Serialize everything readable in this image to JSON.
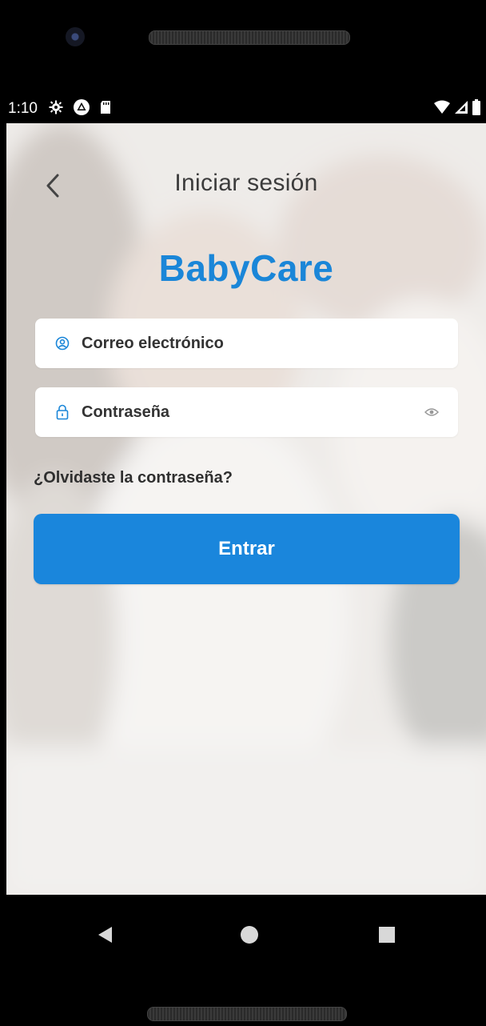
{
  "status_bar": {
    "time": "1:10",
    "icons": [
      "gear-icon",
      "alert-icon",
      "sd-card-icon",
      "wifi-icon",
      "signal-icon",
      "battery-icon"
    ]
  },
  "header": {
    "back_icon": "chevron-left-icon",
    "title": "Iniciar sesión"
  },
  "brand": {
    "name": "BabyCare",
    "color": "#1a86d8"
  },
  "form": {
    "email": {
      "placeholder": "Correo electrónico",
      "value": "",
      "icon": "user-circle-icon"
    },
    "password": {
      "placeholder": "Contraseña",
      "value": "",
      "icon": "lock-icon",
      "toggle_icon": "eye-icon"
    },
    "forgot_password": "¿Olvidaste la contraseña?",
    "submit_label": "Entrar",
    "submit_color": "#1a86dc"
  },
  "nav_bar": {
    "buttons": [
      "back-triangle-icon",
      "home-circle-icon",
      "recents-square-icon"
    ]
  }
}
